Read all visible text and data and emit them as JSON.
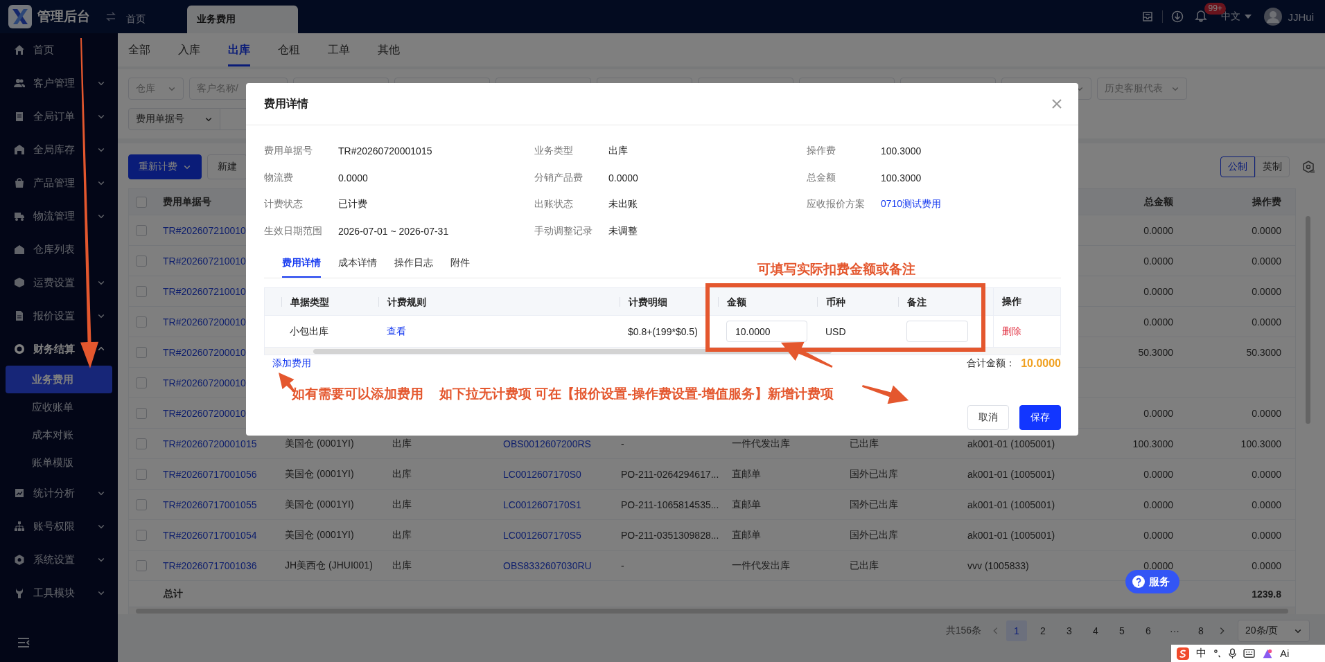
{
  "header": {
    "title": "管理后台",
    "tabs": [
      {
        "label": "首页",
        "selected": false
      },
      {
        "label": "业务费用",
        "selected": true
      }
    ],
    "badge": "99+",
    "language": "中文",
    "user": "JJHui"
  },
  "sidebar": {
    "items": [
      {
        "label": "首页",
        "selected": false
      },
      {
        "label": "客户管理",
        "selected": false,
        "expanded": false
      },
      {
        "label": "全局订单",
        "selected": false,
        "expanded": false
      },
      {
        "label": "全局库存",
        "selected": false,
        "expanded": false
      },
      {
        "label": "产品管理",
        "selected": false,
        "expanded": false
      },
      {
        "label": "物流管理",
        "selected": false,
        "expanded": false
      },
      {
        "label": "仓库列表",
        "selected": false
      },
      {
        "label": "运费设置",
        "selected": false,
        "expanded": false
      },
      {
        "label": "报价设置",
        "selected": false,
        "expanded": false
      },
      {
        "label": "财务结算",
        "selected": false,
        "expanded": true,
        "children": [
          {
            "label": "业务费用",
            "selected": true
          },
          {
            "label": "应收账单",
            "selected": false
          },
          {
            "label": "成本对账",
            "selected": false
          },
          {
            "label": "账单模版",
            "selected": false
          }
        ]
      },
      {
        "label": "统计分析",
        "selected": false,
        "expanded": false
      },
      {
        "label": "账号权限",
        "selected": false,
        "expanded": false
      },
      {
        "label": "系统设置",
        "selected": false,
        "expanded": false
      },
      {
        "label": "工具模块",
        "selected": false,
        "expanded": false
      }
    ]
  },
  "category_tabs": [
    {
      "label": "全部",
      "selected": false
    },
    {
      "label": "入库",
      "selected": false
    },
    {
      "label": "出库",
      "selected": true
    },
    {
      "label": "仓租",
      "selected": false
    },
    {
      "label": "工单",
      "selected": false
    },
    {
      "label": "其他",
      "selected": false
    }
  ],
  "filters": {
    "row_1": [
      {
        "kind": "select",
        "placeholder": "仓库"
      },
      {
        "kind": "input",
        "placeholder": "客户名称/"
      },
      {
        "kind": "input"
      },
      {
        "kind": "input"
      },
      {
        "kind": "input"
      },
      {
        "kind": "input"
      },
      {
        "kind": "input"
      },
      {
        "kind": "input"
      },
      {
        "kind": "input"
      },
      {
        "kind": "select"
      },
      {
        "kind": "select",
        "placeholder": "历史客服代表"
      }
    ],
    "row_2": [
      {
        "kind": "select",
        "value": "费用单据号"
      },
      {
        "kind": "input"
      }
    ]
  },
  "toolbar": {
    "buttons": [
      {
        "label": "重新计费",
        "kind": "primary"
      },
      {
        "label": "新建",
        "kind": "default"
      }
    ],
    "units": [
      {
        "label": "公制",
        "selected": true
      },
      {
        "label": "英制",
        "selected": false
      }
    ]
  },
  "table": {
    "select_all": {
      "checked": false
    },
    "columns": [
      {
        "label": "费用单据号",
        "link": true,
        "numeric": false
      },
      {
        "link": false,
        "numeric": false
      },
      {
        "link": false,
        "numeric": false
      },
      {
        "link": true,
        "numeric": false
      },
      {
        "link": false,
        "numeric": false
      },
      {
        "link": false,
        "numeric": false
      },
      {
        "link": false,
        "numeric": false
      },
      {
        "link": false,
        "numeric": false
      },
      {
        "label": "总金额",
        "link": false,
        "numeric": true
      },
      {
        "label": "操作费",
        "link": false,
        "numeric": true
      }
    ],
    "rows": [
      {
        "checked": false,
        "cells": [
          "TR#202607210010",
          null,
          null,
          null,
          null,
          null,
          null,
          null,
          "0.0000",
          "0.0000"
        ]
      },
      {
        "checked": false,
        "cells": [
          "TR#202607210010",
          null,
          null,
          null,
          null,
          null,
          null,
          null,
          "0.0000",
          "0.0000"
        ]
      },
      {
        "checked": false,
        "cells": [
          "TR#202607210010",
          null,
          null,
          null,
          null,
          null,
          null,
          null,
          "0.0000",
          "0.0000"
        ]
      },
      {
        "checked": false,
        "cells": [
          "TR#202607200010",
          null,
          null,
          null,
          null,
          null,
          null,
          null,
          "0.0000",
          "0.0000"
        ]
      },
      {
        "checked": false,
        "cells": [
          "TR#202607200010",
          null,
          null,
          null,
          null,
          null,
          null,
          null,
          "50.3000",
          "50.3000"
        ]
      },
      {
        "checked": false,
        "cells": [
          "TR#202607200010",
          null,
          null,
          null,
          null,
          null,
          null,
          null,
          null,
          null
        ]
      },
      {
        "checked": false,
        "cells": [
          "TR#202607200010",
          null,
          null,
          null,
          null,
          null,
          null,
          null,
          "0.0000",
          "0.0000"
        ]
      },
      {
        "checked": false,
        "cells": [
          "TR#20260720001015",
          "美国仓 (0001YI)",
          "出库",
          "OBS0012607200RS",
          "-",
          "一件代发出库",
          "已出库",
          "ak001-01 (1005001)",
          "100.3000",
          "100.3000"
        ]
      },
      {
        "checked": false,
        "cells": [
          "TR#20260717001056",
          "美国仓 (0001YI)",
          "出库",
          "LC0012607170S0",
          "PO-211-0264294617...",
          "直邮单",
          "国外已出库",
          "ak001-01 (1005001)",
          "0.0000",
          "0.0000"
        ]
      },
      {
        "checked": false,
        "cells": [
          "TR#20260717001055",
          "美国仓 (0001YI)",
          "出库",
          "LC0012607170S1",
          "PO-211-1065814535...",
          "直邮单",
          "国外已出库",
          "ak001-01 (1005001)",
          "0.0000",
          "0.0000"
        ]
      },
      {
        "checked": false,
        "cells": [
          "TR#20260717001054",
          "美国仓 (0001YI)",
          "出库",
          "LC0012607170S5",
          "PO-211-0351309828...",
          "直邮单",
          "国外已出库",
          "ak001-01 (1005001)",
          "0.0000",
          "0.0000"
        ]
      },
      {
        "checked": false,
        "cells": [
          "TR#20260717001036",
          "JH美西仓 (JHUI001)",
          "出库",
          "OBS8332607030RU",
          "-",
          "一件代发出库",
          "已出库",
          "vvv (1005833)",
          "0.0000",
          "0.0000"
        ]
      }
    ],
    "summary": {
      "label": "总计",
      "op_fee": "1239.8"
    }
  },
  "pagination": {
    "total": "共156条",
    "pages": [
      {
        "label": "1",
        "selected": true
      },
      {
        "label": "2",
        "selected": false
      },
      {
        "label": "3",
        "selected": false
      },
      {
        "label": "4",
        "selected": false
      },
      {
        "label": "5",
        "selected": false
      },
      {
        "label": "6",
        "selected": false
      },
      {
        "label": "···",
        "selected": false
      },
      {
        "label": "8",
        "selected": false
      }
    ],
    "page_size": "20条/页"
  },
  "service_button": {
    "label": "服务"
  },
  "modal": {
    "title": "费用详情",
    "info": [
      {
        "label": "费用单据号",
        "value": "TR#20260720001015",
        "link": false
      },
      {
        "label": "业务类型",
        "value": "出库",
        "link": false
      },
      {
        "label": "操作费",
        "value": "100.3000",
        "link": false
      },
      {
        "label": "物流费",
        "value": "0.0000",
        "link": false
      },
      {
        "label": "分销产品费",
        "value": "0.0000",
        "link": false
      },
      {
        "label": "总金额",
        "value": "100.3000",
        "link": false
      },
      {
        "label": "计费状态",
        "value": "已计费",
        "link": false
      },
      {
        "label": "出账状态",
        "value": "未出账",
        "link": false
      },
      {
        "label": "应收报价方案",
        "value": "0710测试费用",
        "link": true
      },
      {
        "label": "生效日期范围",
        "value": "2026-07-01 ~ 2026-07-31",
        "link": false
      },
      {
        "label": "手动调整记录",
        "value": "未调整",
        "link": false
      }
    ],
    "tabs": [
      {
        "label": "费用详情",
        "selected": true
      },
      {
        "label": "成本详情",
        "selected": false
      },
      {
        "label": "操作日志",
        "selected": false
      },
      {
        "label": "附件",
        "selected": false
      }
    ],
    "table": {
      "columns": [
        "单据类型",
        "计费规则",
        "计费明细",
        "金额",
        "币种",
        "备注",
        "操作"
      ],
      "rows": [
        {
          "type": "小包出库",
          "rule": "查看",
          "detail": "$0.8+(199*$0.5)",
          "amount": "10.0000",
          "currency": "USD",
          "action": "删除"
        }
      ]
    },
    "add_link": "添加费用",
    "total_label": "合计金额：",
    "total": "10.0000",
    "buttons": [
      {
        "label": "取消",
        "kind": "default"
      },
      {
        "label": "保存",
        "kind": "primary"
      }
    ]
  },
  "annotations": [
    {
      "text": "可填写实际扣费金额或备注"
    },
    {
      "text": "如有需要可以添加费用"
    },
    {
      "text": "如下拉无计费项 可在【报价设置-操作费设置-增值服务】新增计费项"
    }
  ],
  "tray": {
    "labels": [
      "中",
      "Ai"
    ]
  }
}
